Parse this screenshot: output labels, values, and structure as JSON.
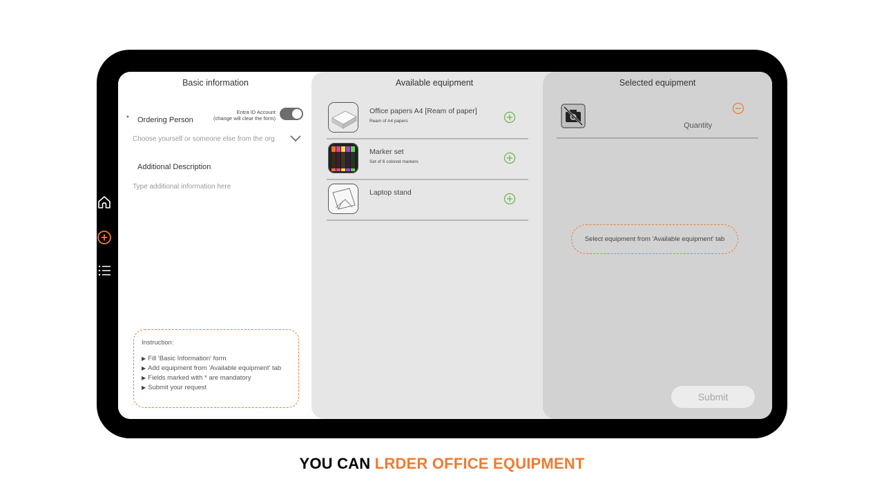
{
  "colors": {
    "accent": "#f07b32",
    "add_green": "#6cb34a",
    "bezel": "#000000"
  },
  "nav": {
    "items": [
      {
        "name": "home",
        "icon": "home-icon"
      },
      {
        "name": "add-order",
        "icon": "plus-circle-icon",
        "active": true
      },
      {
        "name": "orders-list",
        "icon": "list-icon"
      }
    ]
  },
  "basic": {
    "title": "Basic information",
    "asterisk": "*",
    "ordering_person_label": "Ordering Person",
    "toggle_caption_line1": "Entra ID Account",
    "toggle_caption_line2": "(change will clear the form)",
    "toggle_on": true,
    "org_select_placeholder": "Choose yourself or someone else from the org",
    "additional_label": "Additional Description",
    "additional_placeholder": "Type additional information here",
    "instructions": {
      "title": "Instruction:",
      "items": [
        "Fill 'Basic Information' form",
        "Add equipment from 'Available equipment' tab",
        "Fields marked with * are mandatory",
        "Submit your request"
      ]
    }
  },
  "available": {
    "title": "Available equipment",
    "items": [
      {
        "name": "Office papers A4 [Ream of paper]",
        "description": "Ream of A4 papers",
        "icon": "paper-ream-icon"
      },
      {
        "name": "Marker set",
        "description": "Set of 6 colored markers",
        "icon": "marker-set-icon"
      },
      {
        "name": "Laptop stand",
        "description": "",
        "icon": "laptop-stand-icon"
      }
    ]
  },
  "selected": {
    "title": "Selected equipment",
    "quantity_label": "Quantity",
    "hint": "Select equipment from 'Available equipment' tab",
    "submit_label": "Submit"
  },
  "caption": {
    "part1": "YOU CAN ",
    "part2": "LRDER OFFICE EQUIPMENT"
  }
}
